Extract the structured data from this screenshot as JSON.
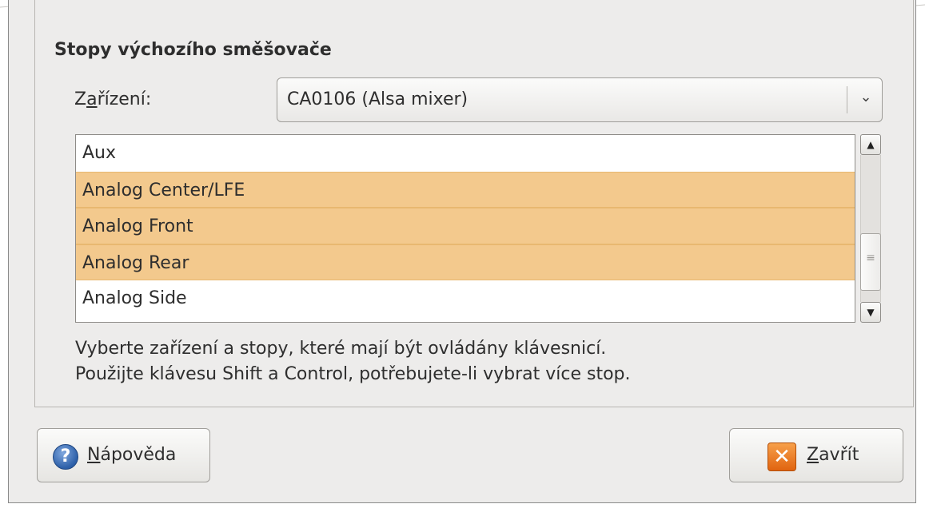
{
  "section": {
    "title": "Stopy výchozího směšovače"
  },
  "device": {
    "label_before": "Z",
    "label_mnemonic": "a",
    "label_after": "řízení:",
    "selected": "CA0106 (Alsa mixer)"
  },
  "tracks": [
    {
      "name": "Aux",
      "selected": false
    },
    {
      "name": "Analog Center/LFE",
      "selected": true
    },
    {
      "name": "Analog Front",
      "selected": true
    },
    {
      "name": "Analog Rear",
      "selected": true
    },
    {
      "name": "Analog Side",
      "selected": false
    }
  ],
  "hint": {
    "line1": "Vyberte zařízení a stopy, které mají být ovládány klávesnicí.",
    "line2": "Použijte klávesu Shift a Control, potřebujete-li vybrat více stop."
  },
  "buttons": {
    "help": {
      "mnemonic": "N",
      "rest": "ápověda",
      "icon": "help-icon"
    },
    "close": {
      "mnemonic": "Z",
      "rest": "avřít",
      "icon": "close-icon"
    }
  },
  "colors": {
    "selection": "#f3c98d",
    "background": "#edeceb"
  }
}
